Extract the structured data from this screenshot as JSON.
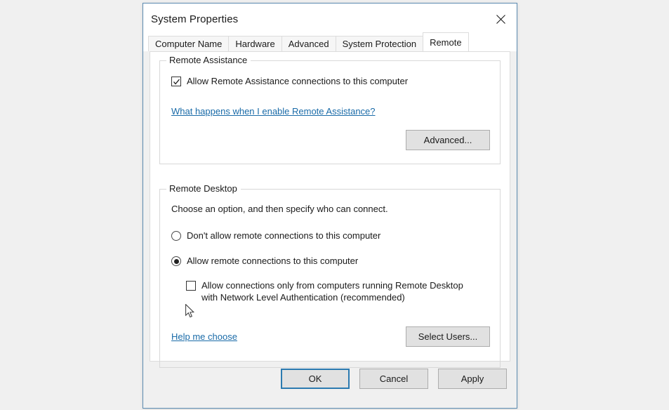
{
  "window": {
    "title": "System Properties",
    "close_icon": "close-icon"
  },
  "tabs": [
    {
      "label": "Computer Name",
      "active": false
    },
    {
      "label": "Hardware",
      "active": false
    },
    {
      "label": "Advanced",
      "active": false
    },
    {
      "label": "System Protection",
      "active": false
    },
    {
      "label": "Remote",
      "active": true
    }
  ],
  "remote_assistance": {
    "group_title": "Remote Assistance",
    "allow_checkbox": {
      "label": "Allow Remote Assistance connections to this computer",
      "checked": true
    },
    "help_link": "What happens when I enable Remote Assistance?",
    "advanced_button": "Advanced..."
  },
  "remote_desktop": {
    "group_title": "Remote Desktop",
    "intro_text": "Choose an option, and then specify who can connect.",
    "options": [
      {
        "label": "Don't allow remote connections to this computer",
        "selected": false
      },
      {
        "label": "Allow remote connections to this computer",
        "selected": true
      }
    ],
    "nla_checkbox": {
      "line1": "Allow connections only from computers running Remote Desktop",
      "line2": "with Network Level Authentication (recommended)",
      "checked": false
    },
    "help_link": "Help me choose",
    "select_users_button": "Select Users..."
  },
  "footer": {
    "ok": "OK",
    "cancel": "Cancel",
    "apply": "Apply"
  },
  "colors": {
    "accent": "#2b7ab0",
    "link": "#1a6ba8",
    "dialog_border": "#5b8ab0",
    "button_face": "#e1e1e1",
    "page_background": "#f0f0f0"
  }
}
